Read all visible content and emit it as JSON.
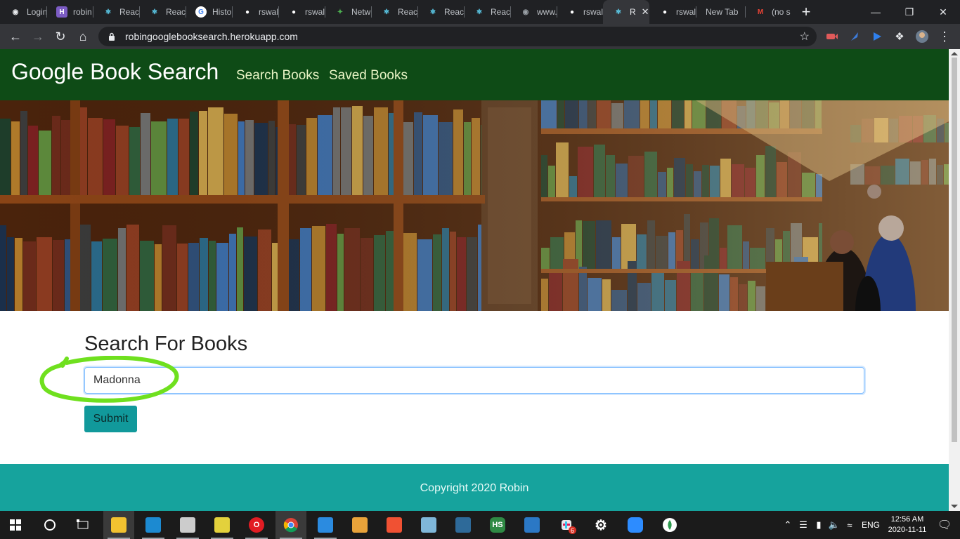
{
  "browser": {
    "tabs": [
      {
        "label": "Login",
        "icon": "generic-globe-icon",
        "color": "#e8eaed"
      },
      {
        "label": "robin",
        "icon": "heroku-icon",
        "color": "#7c5cc4"
      },
      {
        "label": "React",
        "icon": "react-icon",
        "color": "#61dafb"
      },
      {
        "label": "React",
        "icon": "react-icon",
        "color": "#61dafb"
      },
      {
        "label": "Histo",
        "icon": "google-icon",
        "color": "#ffffff"
      },
      {
        "label": "rswal",
        "icon": "github-icon",
        "color": "#ffffff"
      },
      {
        "label": "rswal",
        "icon": "github-icon",
        "color": "#ffffff"
      },
      {
        "label": "Netw",
        "icon": "mongodb-leaf-icon",
        "color": "#4caf50"
      },
      {
        "label": "React",
        "icon": "react-icon",
        "color": "#61dafb"
      },
      {
        "label": "React",
        "icon": "react-icon",
        "color": "#61dafb"
      },
      {
        "label": "React",
        "icon": "react-icon",
        "color": "#61dafb"
      },
      {
        "label": "www.",
        "icon": "globe-icon",
        "color": "#9aa0a6"
      },
      {
        "label": "rswal",
        "icon": "github-icon",
        "color": "#ffffff"
      },
      {
        "label": "R",
        "icon": "react-icon",
        "color": "#61dafb",
        "active": true
      },
      {
        "label": "rswal",
        "icon": "github-icon",
        "color": "#ffffff"
      },
      {
        "label": "New Tab",
        "icon": "",
        "color": ""
      },
      {
        "label": "(no s",
        "icon": "gmail-icon",
        "color": "#ea4335"
      }
    ],
    "url": "robingooglebooksearch.herokuapp.com"
  },
  "site": {
    "brand": "Google Book Search",
    "nav": {
      "search": "Search Books",
      "saved": "Saved Books"
    },
    "colors": {
      "navbar": "#0e4b16",
      "footer": "#16a39d",
      "button": "#11999b",
      "highlight": "#6fe01e"
    }
  },
  "search": {
    "title": "Search For Books",
    "query": "Madonna",
    "submit_label": "Submit"
  },
  "footer": {
    "copyright": "Copyright 2020 Robin"
  },
  "taskbar": {
    "apps": [
      "start-icon",
      "search-icon",
      "task-view-icon",
      "file-explorer-icon",
      "edge-icon",
      "snip-icon",
      "sticky-notes-icon",
      "opera-icon",
      "chrome-icon",
      "vscode-icon",
      "paint-icon",
      "git-icon",
      "stack-icon",
      "mysql-icon",
      "hs-icon",
      "movie-icon",
      "slack-icon",
      "settings-icon",
      "zoom-icon",
      "mongodb-icon"
    ],
    "slack_badge": "6",
    "language": "ENG",
    "time": "12:56 AM",
    "date": "2020-11-11"
  }
}
